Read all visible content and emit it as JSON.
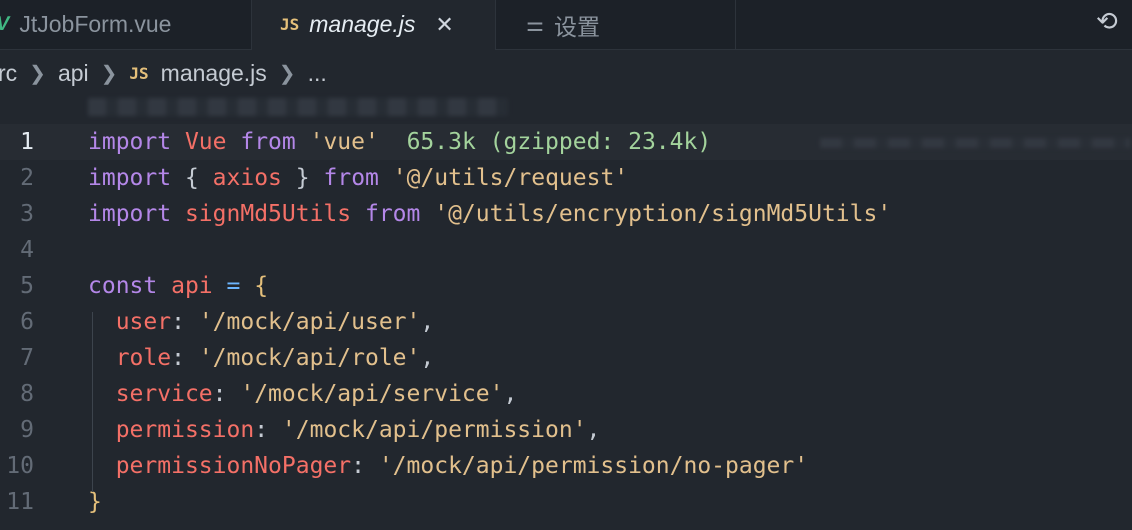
{
  "tabs": [
    {
      "label": "JtJobForm.vue",
      "icon": "vue-icon"
    },
    {
      "label": "manage.js",
      "icon": "js-icon",
      "icon_text": "JS",
      "active": true,
      "close": "✕"
    },
    {
      "label": "设置",
      "icon": "settings-icon"
    }
  ],
  "breadcrumb": {
    "items": [
      "rc",
      "api",
      "manage.js",
      "..."
    ],
    "js_text": "JS"
  },
  "editor": {
    "import_hint": "65.3k (gzipped: 23.4k)",
    "line_numbers": [
      "1",
      "2",
      "3",
      "4",
      "5",
      "6",
      "7",
      "8",
      "9",
      "10",
      "11"
    ]
  },
  "colors": {
    "keyword": "#b487e8",
    "identifier": "#f47067",
    "string": "#e2c08d",
    "background": "#22272e"
  }
}
